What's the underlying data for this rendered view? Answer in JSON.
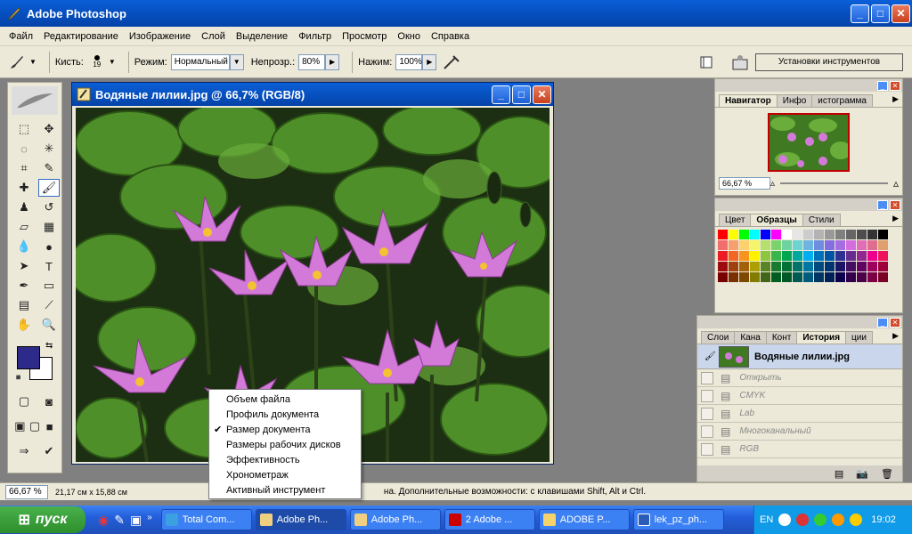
{
  "app": {
    "title": "Adobe Photoshop"
  },
  "menu": [
    "Файл",
    "Редактирование",
    "Изображение",
    "Слой",
    "Выделение",
    "Фильтр",
    "Просмотр",
    "Окно",
    "Справка"
  ],
  "options": {
    "brush_label": "Кисть:",
    "brush_size": "19",
    "mode_label": "Режим:",
    "mode_value": "Нормальный",
    "opacity_label": "Непрозр.:",
    "opacity_value": "80%",
    "flow_label": "Нажим:",
    "flow_value": "100%",
    "presets_label": "Установки инструментов"
  },
  "document": {
    "title": "Водяные лилии.jpg @ 66,7% (RGB/8)"
  },
  "status": {
    "zoom": "66,67 %",
    "docsize": "21,17 см x 15,88 см",
    "hint": "на. Дополнительные возможности: с клавишами Shift, Alt и Ctrl."
  },
  "dropdown": {
    "items": [
      {
        "label": "Объем файла",
        "checked": false
      },
      {
        "label": "Профиль документа",
        "checked": false
      },
      {
        "label": "Размер документа",
        "checked": true
      },
      {
        "label": "Размеры рабочих дисков",
        "checked": false
      },
      {
        "label": "Эффективность",
        "checked": false
      },
      {
        "label": "Хронометраж",
        "checked": false
      },
      {
        "label": "Активный инструмент",
        "checked": false
      }
    ]
  },
  "navigator": {
    "tabs": [
      "Навигатор",
      "Инфо",
      "истограмма"
    ],
    "zoom": "66,67 %"
  },
  "swatches": {
    "tabs": [
      "Цвет",
      "Образцы",
      "Стили"
    ]
  },
  "history": {
    "tabs": [
      "Слои",
      "Кана",
      "Конт",
      "История",
      "ции"
    ],
    "snapshot": "Водяные лилии.jpg",
    "steps": [
      "Открыть",
      "CMYK",
      "Lab",
      "Многоканальный",
      "RGB"
    ]
  },
  "taskbar": {
    "start": "пуск",
    "tasks": [
      "Total Com...",
      "Adobe Ph...",
      "Adobe Ph...",
      "2 Adobe ...",
      "ADOBE P...",
      "lek_pz_ph..."
    ],
    "lang": "EN",
    "clock": "19:02"
  },
  "colors": {
    "foreground": "#2e2a8a",
    "background": "#ffffff",
    "title_blue": "#0752c4"
  }
}
